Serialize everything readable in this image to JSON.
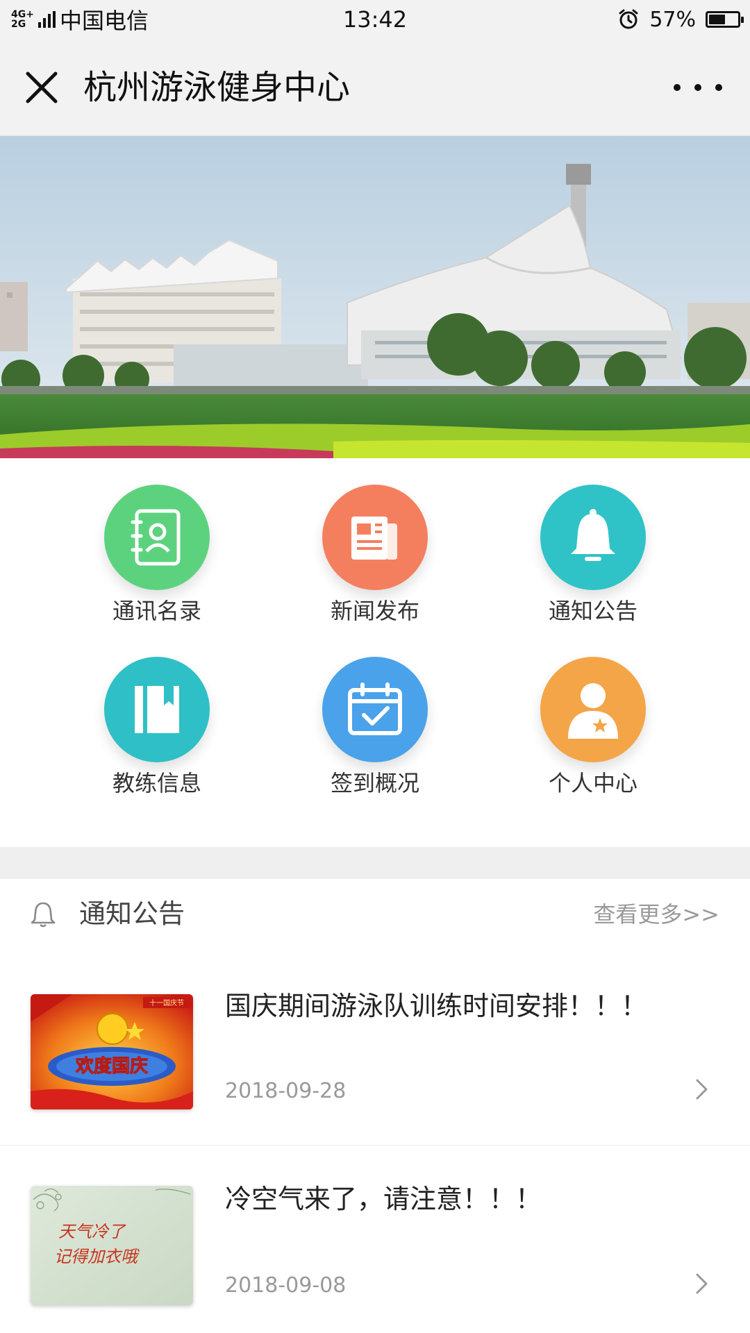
{
  "status_bar": {
    "network_top": "4G+",
    "network_bottom": "2G",
    "carrier": "中国电信",
    "time": "13:42",
    "battery_percent": "57%",
    "battery_level": 0.57
  },
  "nav": {
    "title": "杭州游泳健身中心",
    "close_icon": "close-icon",
    "more_icon": "more-icon"
  },
  "banner": {
    "description_icon": "building-photo"
  },
  "grid": {
    "items": [
      {
        "label": "通讯名录",
        "icon": "contacts-icon",
        "color": "#5dd27e"
      },
      {
        "label": "新闻发布",
        "icon": "newspaper-icon",
        "color": "#f47f5f"
      },
      {
        "label": "通知公告",
        "icon": "bell-icon",
        "color": "#2fc3c7"
      },
      {
        "label": "教练信息",
        "icon": "book-icon",
        "color": "#2ec0c6"
      },
      {
        "label": "签到概况",
        "icon": "calendar-check-icon",
        "color": "#4aa2ea"
      },
      {
        "label": "个人中心",
        "icon": "user-star-icon",
        "color": "#f4a548"
      }
    ]
  },
  "notices": {
    "title": "通知公告",
    "more": "查看更多>>",
    "items": [
      {
        "title": "国庆期间游泳队训练时间安排！！！",
        "date": "2018-09-28",
        "thumb_text": "欢度国庆",
        "thumb_badge": "十一国庆节"
      },
      {
        "title": "冷空气来了，请注意！！！",
        "date": "2018-09-08",
        "thumb_text_line1": "天气冷了",
        "thumb_text_line2": "记得加衣哦"
      }
    ]
  },
  "colors": {
    "background": "#ffffff",
    "bar_background": "#f2f2f2",
    "gap_band": "#efefef",
    "muted_text": "#999999"
  }
}
